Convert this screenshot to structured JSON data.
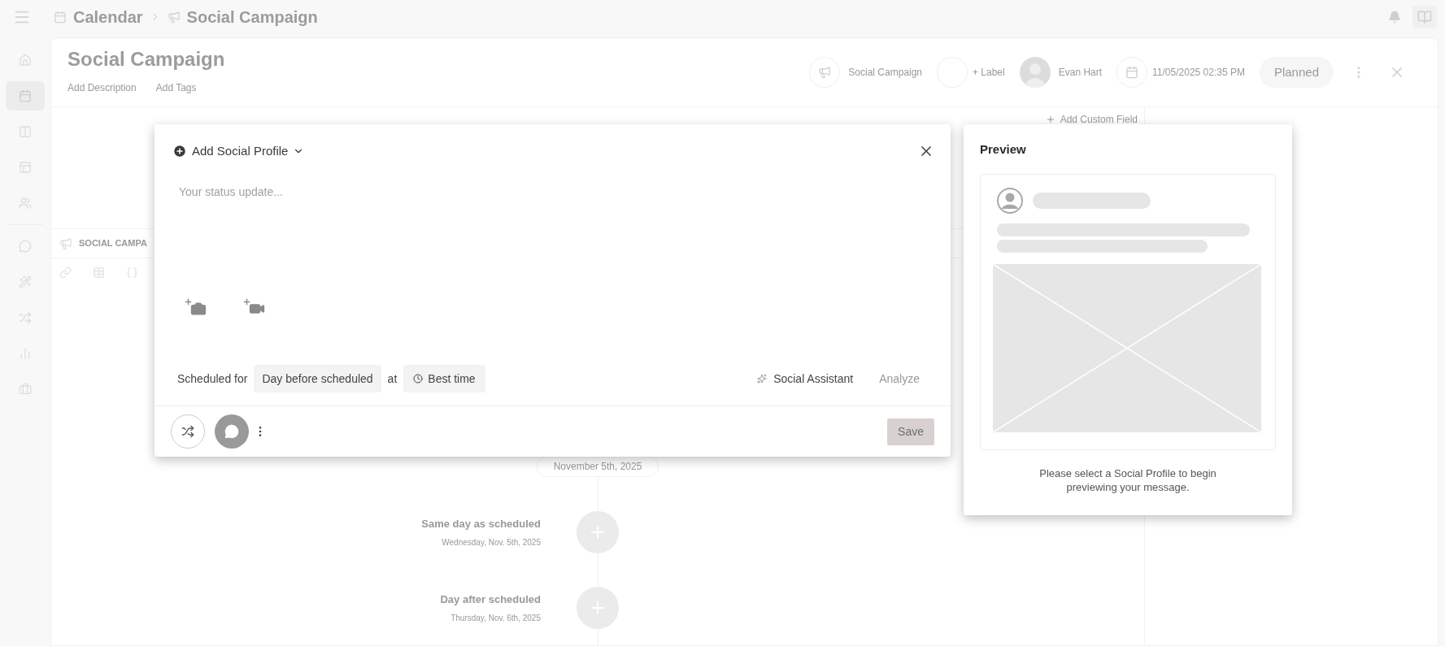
{
  "top_bar": {
    "breadcrumb": [
      {
        "label": "Calendar"
      },
      {
        "label": "Social Campaign"
      }
    ]
  },
  "sidebar": {
    "items": [
      {
        "kind": "home",
        "selected": false
      },
      {
        "kind": "calendar",
        "selected": true
      },
      {
        "kind": "columns",
        "selected": false
      },
      {
        "kind": "layout",
        "selected": false
      },
      {
        "kind": "users",
        "selected": false
      },
      {
        "kind": "chat",
        "selected": false
      },
      {
        "kind": "wand",
        "selected": false
      },
      {
        "kind": "shuffle",
        "selected": false
      },
      {
        "kind": "chart",
        "selected": false
      },
      {
        "kind": "briefcase",
        "selected": false
      }
    ]
  },
  "campaign": {
    "title": "Social Campaign",
    "add_description": "Add Description",
    "add_tags": "Add Tags",
    "type_label": "Social Campaign",
    "label_button": "+ Label",
    "owner": "Evan Hart",
    "date": "11/05/2025 02:35 PM",
    "status": "Planned",
    "add_custom_field": "Add Custom Field"
  },
  "section": {
    "title": "SOCIAL CAMPA"
  },
  "timeline": {
    "date": "November 5th, 2025",
    "steps": [
      {
        "title": "Same day as scheduled",
        "date": "Wednesday, Nov. 5th, 2025"
      },
      {
        "title": "Day after scheduled",
        "date": "Thursday, Nov. 6th, 2025"
      }
    ]
  },
  "composer": {
    "add_profile": "Add Social Profile",
    "placeholder": "Your status update...",
    "scheduled_label": "Scheduled for",
    "schedule_option": "Day before scheduled",
    "at": "at",
    "time_option": "Best time",
    "assistant": "Social Assistant",
    "analyze": {
      "label": "Analyze",
      "disabled": true
    },
    "save": {
      "label": "Save",
      "disabled": true
    }
  },
  "preview": {
    "title": "Preview",
    "message": "Please select a Social Profile to begin previewing your message."
  }
}
